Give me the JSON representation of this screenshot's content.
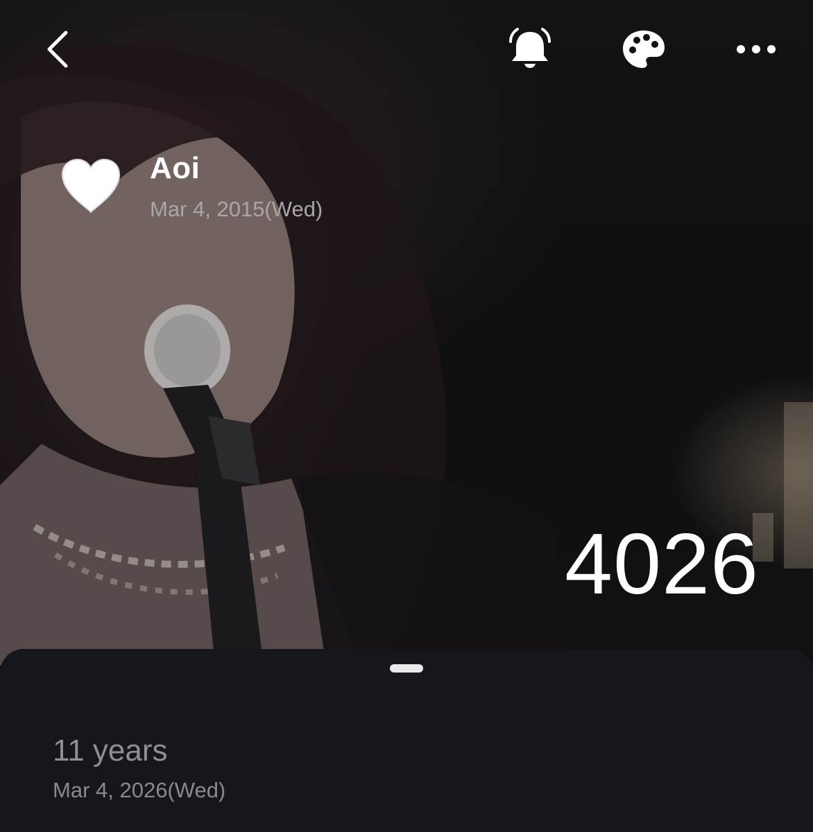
{
  "toolbar": {
    "back_icon": "chevron-left-icon",
    "bell_icon": "ringing-bell-icon",
    "palette_icon": "palette-icon",
    "more_icon": "ellipsis-horizontal-icon"
  },
  "profile": {
    "icon": "heart-icon",
    "name": "Aoi",
    "start_date": "Mar 4, 2015(Wed)"
  },
  "counter": {
    "days": "4026"
  },
  "sheet": {
    "years_label": "11 years",
    "target_date": "Mar 4, 2026(Wed)"
  },
  "colors": {
    "background": "#0e0e10",
    "sheet": "#16171c",
    "primary_text": "#ffffff",
    "secondary_text": "#a9a6aa",
    "muted_text": "#8f8e96"
  }
}
